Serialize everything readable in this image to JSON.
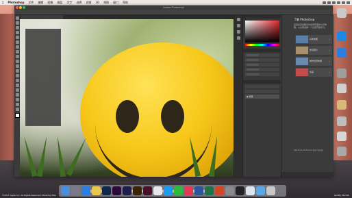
{
  "menubar": {
    "app": "Photoshop",
    "items": [
      "文件",
      "编辑",
      "图像",
      "图层",
      "文字",
      "选择",
      "滤镜",
      "3D",
      "视图",
      "窗口",
      "帮助"
    ]
  },
  "window": {
    "title": "Adobe Photoshop"
  },
  "learn_panel": {
    "title": "了解 Photoshop",
    "description": "直接在应用程序中选择所需的分步教程。从左侧选择一个主题开始学习。",
    "cards": [
      {
        "label": "基本技能",
        "thumb_color": "#5a7ea8"
      },
      {
        "label": "修复照片",
        "thumb_color": "#a88f6d"
      },
      {
        "label": "制作创意效果",
        "thumb_color": "#6b8ab0"
      },
      {
        "label": "绘画",
        "thumb_color": "#c24b4b"
      }
    ],
    "tip": "了解 Adobe Photoshop 的各个新功能"
  },
  "layers": {
    "selected_layer": "背景"
  },
  "status": {
    "left": "©2017 Apple Inc. All Rights Reserved. Made By iMac",
    "right": "Get By: MacNX"
  },
  "colors": {
    "accent": "#e0262b",
    "ui_bg": "#323232"
  },
  "dock_icons": [
    {
      "name": "finder-icon",
      "color": "#4a8fdc"
    },
    {
      "name": "launchpad-icon",
      "color": "#7a7a8a"
    },
    {
      "name": "safari-icon",
      "color": "#2b7fe0"
    },
    {
      "name": "photos-icon",
      "color": "#e9c64f"
    },
    {
      "name": "photoshop-icon",
      "color": "#0e2a4a"
    },
    {
      "name": "premiere-icon",
      "color": "#2a0b3a"
    },
    {
      "name": "aftereffects-icon",
      "color": "#1f1d4b"
    },
    {
      "name": "illustrator-icon",
      "color": "#3b2208"
    },
    {
      "name": "indesign-icon",
      "color": "#49102a"
    },
    {
      "name": "chrome-icon",
      "color": "#e8e8e8"
    },
    {
      "name": "qq-icon",
      "color": "#1d9bf0"
    },
    {
      "name": "wechat-icon",
      "color": "#2dbb3b"
    },
    {
      "name": "music-icon",
      "color": "#e23a55"
    },
    {
      "name": "word-icon",
      "color": "#2b579a"
    },
    {
      "name": "excel-icon",
      "color": "#217346"
    },
    {
      "name": "powerpoint-icon",
      "color": "#d24726"
    },
    {
      "name": "systemprefs-icon",
      "color": "#8b8b8b"
    },
    {
      "name": "terminal-icon",
      "color": "#222222"
    },
    {
      "name": "preview-icon",
      "color": "#dde6ee"
    },
    {
      "name": "folder-icon",
      "color": "#5ba7e6"
    },
    {
      "name": "trash-icon",
      "color": "#c8c8c8"
    }
  ]
}
